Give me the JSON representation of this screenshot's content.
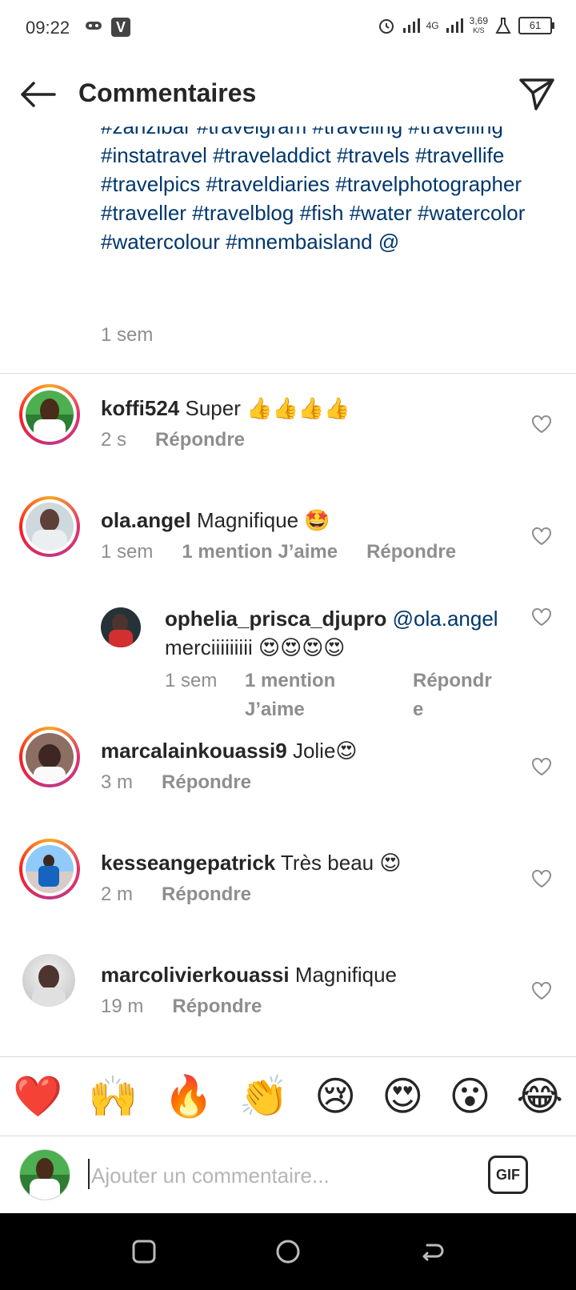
{
  "status_bar": {
    "time": "09:22",
    "network": "4G",
    "speed": "3,69",
    "speed_unit": "K/S",
    "battery": "61"
  },
  "header": {
    "title": "Commentaires"
  },
  "caption": {
    "hashtags": "#zanzibar #travelgram #traveling #travelling #instatravel #traveladdict #travels #travellife #travelpics #traveldiaries #travelphotographer #traveller #travelblog #fish #water #watercolor #watercolour #mnembaisland  @",
    "time": "1 sem"
  },
  "comments": [
    {
      "username": "koffi524",
      "text": "Super 👍👍👍👍",
      "time": "2 s",
      "reply": "Répondre"
    },
    {
      "username": "ola.angel",
      "text": "Magnifique 🤩",
      "time": "1 sem",
      "likes": "1 mention J’aime",
      "reply": "Répondre"
    },
    {
      "username": "ophelia_prisca_djupro",
      "mention": "@ola.angel",
      "text": "merciiiiiiiii 😍😍😍😍",
      "time": "1 sem",
      "likes": "1 mention J’aime",
      "reply": "Répondre"
    },
    {
      "username": "marcalainkouassi9",
      "text": "Jolie😍",
      "time": "3 m",
      "reply": "Répondre"
    },
    {
      "username": "kesseangepatrick",
      "text": "Très beau 😍",
      "time": "2 m",
      "reply": "Répondre"
    },
    {
      "username": "marcolivierkouassi",
      "text": "Magnifique",
      "time": "19 m",
      "reply": "Répondre"
    }
  ],
  "emoji_bar": [
    "❤️",
    "🙌",
    "🔥",
    "👏",
    "😢",
    "😍",
    "😮",
    "😂"
  ],
  "composer": {
    "placeholder": "Ajouter un commentaire...",
    "gif_label": "GIF"
  },
  "colors": {
    "hashtag": "#00376b",
    "secondary_text": "#8e8e8e",
    "ring_gradient": [
      "#f9a825",
      "#e1306c",
      "#c13584"
    ]
  }
}
